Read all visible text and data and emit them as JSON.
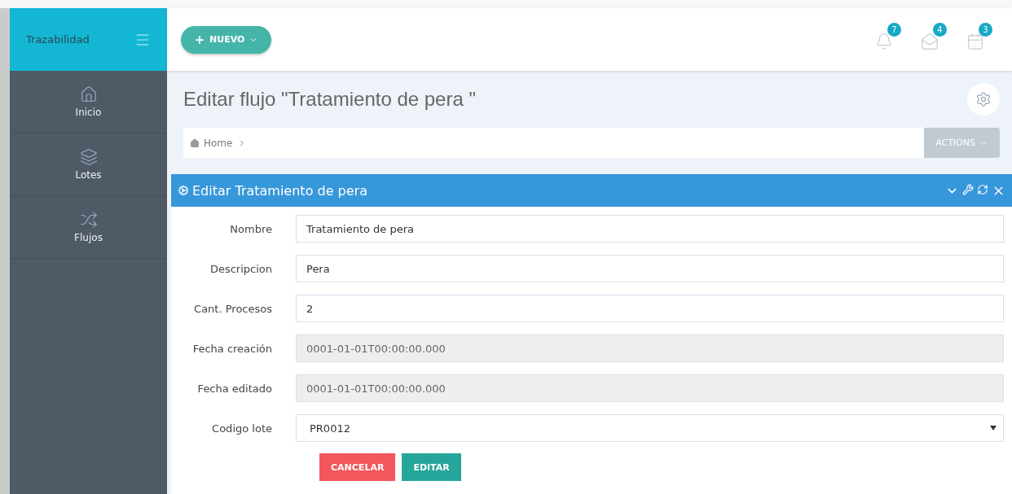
{
  "sidebar": {
    "brand": "Trazabilidad",
    "items": [
      {
        "label": "Inicio"
      },
      {
        "label": "Lotes"
      },
      {
        "label": "Flujos"
      }
    ]
  },
  "topbar": {
    "new_button": "NUEVO",
    "notifications": [
      {
        "count": "7"
      },
      {
        "count": "4"
      },
      {
        "count": "3"
      }
    ]
  },
  "page": {
    "title": "Editar flujo \"Tratamiento de pera \"",
    "breadcrumb": [
      "Home"
    ],
    "actions_button": "ACTIONS"
  },
  "panel": {
    "title": "Editar Tratamiento de pera",
    "fields": [
      {
        "label": "Nombre",
        "kind": "text",
        "value": "Tratamiento de pera",
        "disabled": false
      },
      {
        "label": "Descripcion",
        "kind": "text",
        "value": "Pera",
        "disabled": false
      },
      {
        "label": "Cant. Procesos",
        "kind": "text",
        "value": "2",
        "disabled": false
      },
      {
        "label": "Fecha creación",
        "kind": "text",
        "value": "0001-01-01T00:00:00.000",
        "disabled": true
      },
      {
        "label": "Fecha editado",
        "kind": "text",
        "value": "0001-01-01T00:00:00.000",
        "disabled": true
      },
      {
        "label": "Codigo lote",
        "kind": "select",
        "value": "PR0012",
        "disabled": false
      }
    ],
    "buttons": [
      {
        "label": "CANCELAR",
        "kind": "danger"
      },
      {
        "label": "EDITAR",
        "kind": "primary"
      }
    ]
  }
}
